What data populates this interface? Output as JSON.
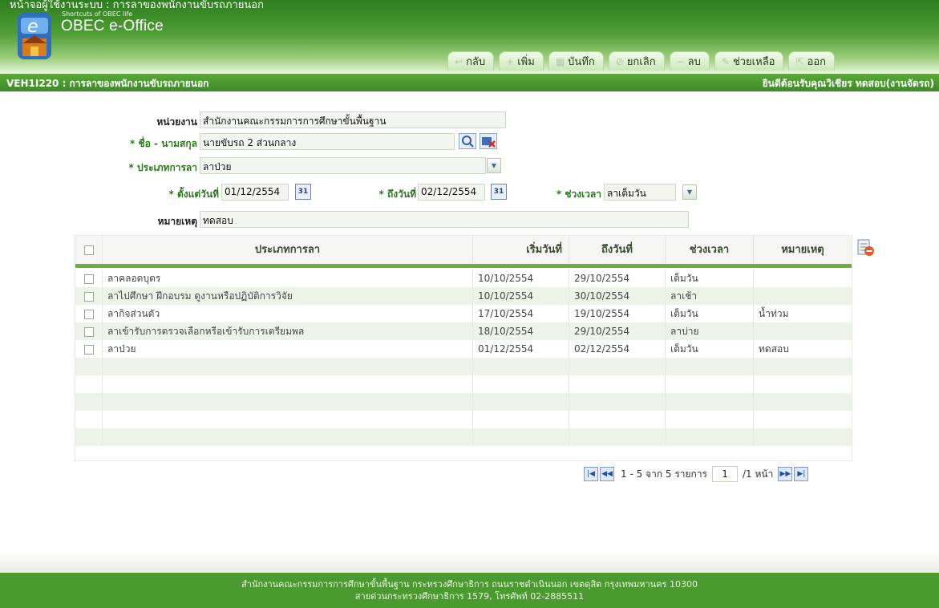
{
  "header": {
    "caption": "หน้าจอผู้ใช้งานระบบ : การลาของพนักงานขับรถภายนอก",
    "logo_tagline": "Shortcuts of OBEC life",
    "logo_title": "OBEC e-Office"
  },
  "toolbar": {
    "back": "กลับ",
    "add": "เพิ่ม",
    "save": "บันทึก",
    "cancel": "ยกเลิก",
    "delete": "ลบ",
    "help": "ช่วยเหลือ",
    "exit": "ออก"
  },
  "titlebar": {
    "screen": "VEH1I220 : การลาของพนักงานขับรถภายนอก",
    "welcome": "ยินดีต้อนรับคุณวิเชียร ทดสอบ(งานจัดรถ)"
  },
  "form": {
    "unit_label": "หน่วยงาน",
    "unit_value": "สำนักงานคณะกรรมการการศึกษาขั้นพื้นฐาน",
    "req_mark": "*",
    "name_label": "ชื่อ - นามสกุล",
    "name_value": "นายขับรถ 2 ส่วนกลาง",
    "leave_type_label": "ประเภทการลา",
    "leave_type_value": "ลาป่วย",
    "from_label": "ตั้งแต่วันที่",
    "from_value": "01/12/2554",
    "to_label": "ถึงวันที่",
    "to_value": "02/12/2554",
    "period_label": "ช่วงเวลา",
    "period_value": "ลาเต็มวัน",
    "remark_label": "หมายเหตุ",
    "remark_value": "ทดสอบ",
    "calendar_glyph": "31"
  },
  "grid": {
    "columns": [
      "ประเภทการลา",
      "เริ่มวันที่",
      "ถึงวันที่",
      "ช่วงเวลา",
      "หมายเหตุ"
    ],
    "rows": [
      [
        "ลาคลอดบุตร",
        "10/10/2554",
        "29/10/2554",
        "เต็มวัน",
        ""
      ],
      [
        "ลาไปศึกษา ฝึกอบรม ดูงานหรือปฏิบัติการวิจัย",
        "10/10/2554",
        "30/10/2554",
        "ลาเช้า",
        ""
      ],
      [
        "ลากิจส่วนตัว",
        "17/10/2554",
        "19/10/2554",
        "เต็มวัน",
        "น้ำท่วม"
      ],
      [
        "ลาเข้ารับการตรวจเลือกหรือเข้ารับการเตรียมพล",
        "18/10/2554",
        "29/10/2554",
        "ลาบ่าย",
        ""
      ],
      [
        "ลาป่วย",
        "01/12/2554",
        "02/12/2554",
        "เต็มวัน",
        "ทดสอบ"
      ]
    ]
  },
  "pager": {
    "range": "1 - 5 จาก 5 รายการ",
    "page": "1",
    "total": "/1 หน้า"
  },
  "footer": {
    "line1": "สำนักงานคณะกรรมการการศึกษาขั้นพื้นฐาน กระทรวงศึกษาธิการ ถนนราชดำเนินนอก เขตดุสิต กรุงเทพมหานคร 10300",
    "line2": "สายด่วนกระทรวงศึกษาธิการ 1579, โทรศัพท์ 02-2885511"
  },
  "colors": {
    "brand_green": "#4a9a2f",
    "accent_green": "#6cae3f",
    "label_green": "#2a7a1a"
  }
}
